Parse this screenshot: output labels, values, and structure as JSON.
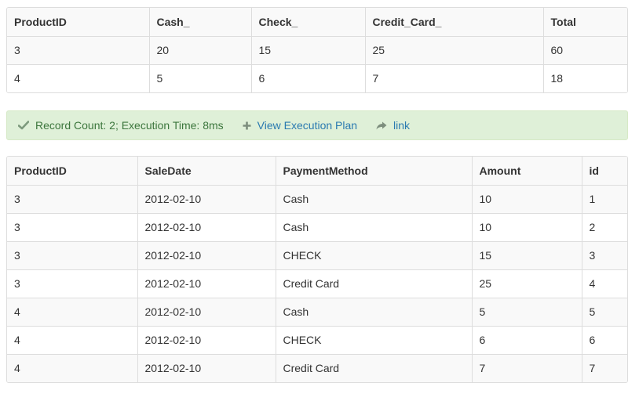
{
  "pivot_table": {
    "headers": [
      "ProductID",
      "Cash_",
      "Check_",
      "Credit_Card_",
      "Total"
    ],
    "rows": [
      [
        "3",
        "20",
        "15",
        "25",
        "60"
      ],
      [
        "4",
        "5",
        "6",
        "7",
        "18"
      ]
    ]
  },
  "status": {
    "message": "Record Count: 2; Execution Time: 8ms",
    "view_plan_label": "View Execution Plan",
    "link_label": "link",
    "icons": [
      "check-icon",
      "plus-icon",
      "share-arrow-icon"
    ],
    "colors": {
      "background": "#dff0d8",
      "text": "#3c763d",
      "link": "#2a7ab0"
    }
  },
  "sales_table": {
    "headers": [
      "ProductID",
      "SaleDate",
      "PaymentMethod",
      "Amount",
      "id"
    ],
    "rows": [
      [
        "3",
        "2012-02-10",
        "Cash",
        "10",
        "1"
      ],
      [
        "3",
        "2012-02-10",
        "Cash",
        "10",
        "2"
      ],
      [
        "3",
        "2012-02-10",
        "CHECK",
        "15",
        "3"
      ],
      [
        "3",
        "2012-02-10",
        "Credit Card",
        "25",
        "4"
      ],
      [
        "4",
        "2012-02-10",
        "Cash",
        "5",
        "5"
      ],
      [
        "4",
        "2012-02-10",
        "CHECK",
        "6",
        "6"
      ],
      [
        "4",
        "2012-02-10",
        "Credit Card",
        "7",
        "7"
      ]
    ]
  }
}
